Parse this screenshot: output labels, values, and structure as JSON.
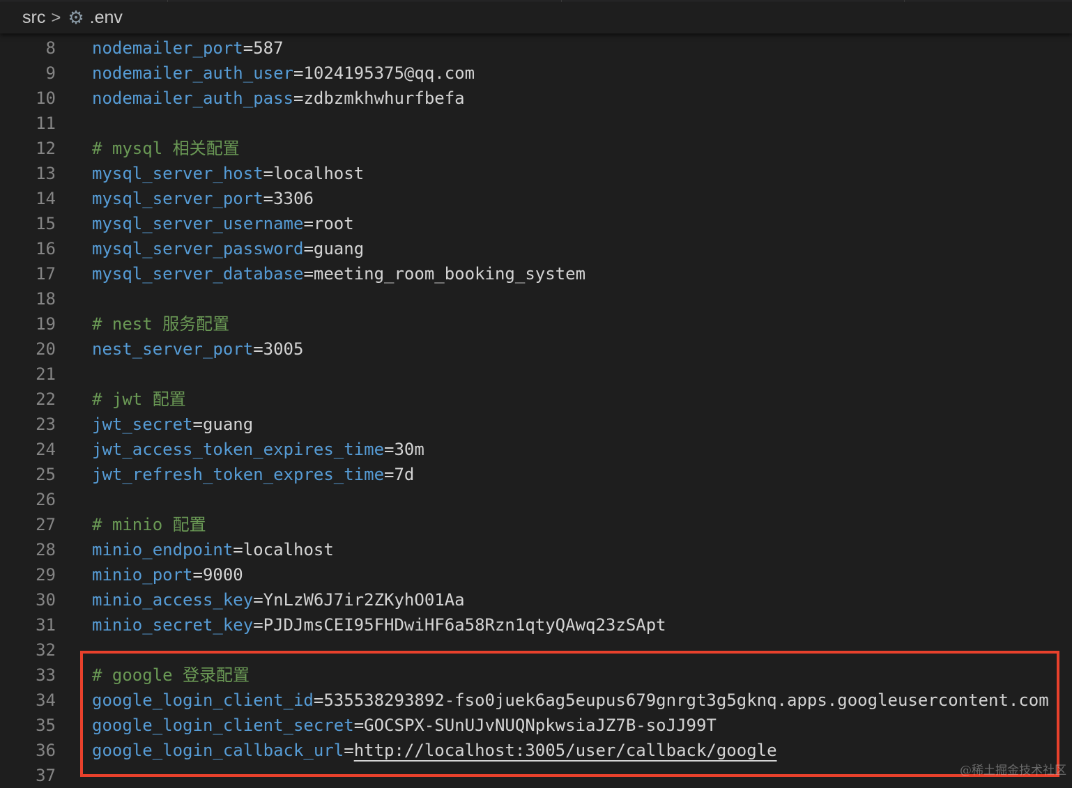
{
  "breadcrumb": {
    "folder": "src",
    "file": ".env",
    "separator": ">"
  },
  "icons": {
    "file_icon": "gear-icon"
  },
  "colors": {
    "key": "#569cd6",
    "value": "#d4d4d4",
    "comment": "#6a9955",
    "highlight_box": "#e8412c"
  },
  "lines": [
    {
      "n": "8",
      "key": "nodemailer_port",
      "value": "587"
    },
    {
      "n": "9",
      "key": "nodemailer_auth_user",
      "value": "1024195375@qq.com"
    },
    {
      "n": "10",
      "key": "nodemailer_auth_pass",
      "value": "zdbzmkhwhurfbefa"
    },
    {
      "n": "11"
    },
    {
      "n": "12",
      "comment": "# mysql 相关配置"
    },
    {
      "n": "13",
      "key": "mysql_server_host",
      "value": "localhost"
    },
    {
      "n": "14",
      "key": "mysql_server_port",
      "value": "3306"
    },
    {
      "n": "15",
      "key": "mysql_server_username",
      "value": "root"
    },
    {
      "n": "16",
      "key": "mysql_server_password",
      "value": "guang"
    },
    {
      "n": "17",
      "key": "mysql_server_database",
      "value": "meeting_room_booking_system"
    },
    {
      "n": "18"
    },
    {
      "n": "19",
      "comment": "# nest 服务配置"
    },
    {
      "n": "20",
      "key": "nest_server_port",
      "value": "3005"
    },
    {
      "n": "21"
    },
    {
      "n": "22",
      "comment": "# jwt 配置"
    },
    {
      "n": "23",
      "key": "jwt_secret",
      "value": "guang"
    },
    {
      "n": "24",
      "key": "jwt_access_token_expires_time",
      "value": "30m"
    },
    {
      "n": "25",
      "key": "jwt_refresh_token_expres_time",
      "value": "7d"
    },
    {
      "n": "26"
    },
    {
      "n": "27",
      "comment": "# minio 配置"
    },
    {
      "n": "28",
      "key": "minio_endpoint",
      "value": "localhost"
    },
    {
      "n": "29",
      "key": "minio_port",
      "value": "9000"
    },
    {
      "n": "30",
      "key": "minio_access_key",
      "value": "YnLzW6J7ir2ZKyhO01Aa"
    },
    {
      "n": "31",
      "key": "minio_secret_key",
      "value": "PJDJmsCEI95FHDwiHF6a58Rzn1qtyQAwq23zSApt"
    },
    {
      "n": "32"
    },
    {
      "n": "33",
      "comment": "# google 登录配置"
    },
    {
      "n": "34",
      "key": "google_login_client_id",
      "value": "535538293892-fso0juek6ag5eupus679gnrgt3g5gknq.apps.googleusercontent.com"
    },
    {
      "n": "35",
      "key": "google_login_client_secret",
      "value": "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"
    },
    {
      "n": "36",
      "key": "google_login_callback_url",
      "url": "http://localhost:3005/user/callback/google"
    },
    {
      "n": "37"
    }
  ],
  "watermark": "@稀土掘金技术社区"
}
